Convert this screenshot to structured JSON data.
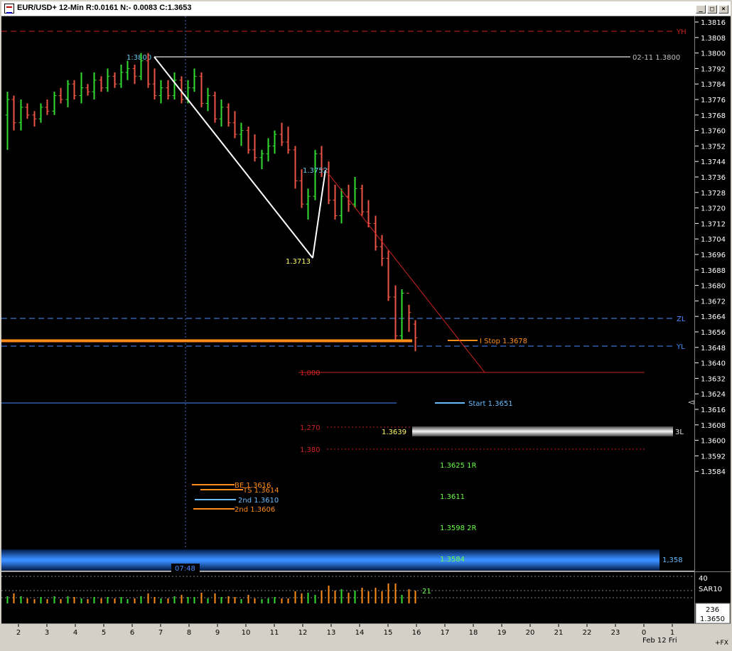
{
  "window": {
    "title": "EUR/USD+ 12-Min R:0.0161 N:- 0.0083 C:1.3653",
    "minimize_glyph": "_",
    "maximize_glyph": "□",
    "close_glyph": "×"
  },
  "chart_data": {
    "type": "candlestick",
    "symbol": "EUR/USD+",
    "interval": "12-Min",
    "ylim": [
      1.358,
      1.382
    ],
    "y_ticks": [
      "1.3816",
      "1.3808",
      "1.3800",
      "1.3792",
      "1.3784",
      "1.3776",
      "1.3768",
      "1.3760",
      "1.3752",
      "1.3744",
      "1.3736",
      "1.3728",
      "1.3720",
      "1.3712",
      "1.3704",
      "1.3696",
      "1.3688",
      "1.3680",
      "1.3672",
      "1.3664",
      "1.3656",
      "1.3648",
      "1.3640",
      "1.3632",
      "1.3624",
      "1.3616",
      "1.3608",
      "1.3600",
      "1.3592",
      "1.3584"
    ],
    "x_ticks": [
      "2",
      "3",
      "4",
      "5",
      "6",
      "7",
      "8",
      "9",
      "10",
      "11",
      "12",
      "13",
      "14",
      "15",
      "16",
      "17",
      "18",
      "19",
      "20",
      "21",
      "22",
      "23",
      "0",
      "1"
    ],
    "date_label": "Feb 12 Fri",
    "crosshair_time": "07:48",
    "bars": [
      [
        1.3768,
        1.378,
        1.375,
        1.3776
      ],
      [
        1.3776,
        1.3778,
        1.376,
        1.3764
      ],
      [
        1.3764,
        1.3776,
        1.376,
        1.3772
      ],
      [
        1.3772,
        1.3774,
        1.3766,
        1.3768
      ],
      [
        1.3768,
        1.377,
        1.3762,
        1.3766
      ],
      [
        1.3766,
        1.3774,
        1.3764,
        1.3772
      ],
      [
        1.3772,
        1.3776,
        1.3768,
        1.377
      ],
      [
        1.377,
        1.378,
        1.3768,
        1.3778
      ],
      [
        1.3778,
        1.3782,
        1.3774,
        1.3776
      ],
      [
        1.3776,
        1.3786,
        1.3772,
        1.3784
      ],
      [
        1.3784,
        1.3786,
        1.3776,
        1.3778
      ],
      [
        1.3778,
        1.379,
        1.3774,
        1.3782
      ],
      [
        1.3782,
        1.3784,
        1.3778,
        1.378
      ],
      [
        1.378,
        1.379,
        1.3776,
        1.3786
      ],
      [
        1.3786,
        1.3788,
        1.378,
        1.3782
      ],
      [
        1.3782,
        1.3792,
        1.378,
        1.3788
      ],
      [
        1.3788,
        1.379,
        1.3782,
        1.3784
      ],
      [
        1.3784,
        1.3794,
        1.3782,
        1.379
      ],
      [
        1.379,
        1.3796,
        1.3786,
        1.3792
      ],
      [
        1.3792,
        1.3794,
        1.3784,
        1.3788
      ],
      [
        1.3788,
        1.38,
        1.3786,
        1.3796
      ],
      [
        1.3796,
        1.38,
        1.3782,
        1.3784
      ],
      [
        1.3784,
        1.3792,
        1.3776,
        1.3778
      ],
      [
        1.3778,
        1.3786,
        1.3774,
        1.3782
      ],
      [
        1.3782,
        1.3786,
        1.3776,
        1.3778
      ],
      [
        1.3778,
        1.379,
        1.3776,
        1.3786
      ],
      [
        1.3786,
        1.3788,
        1.3774,
        1.3776
      ],
      [
        1.3776,
        1.3786,
        1.3774,
        1.3782
      ],
      [
        1.3782,
        1.3792,
        1.378,
        1.3788
      ],
      [
        1.3788,
        1.379,
        1.3772,
        1.3774
      ],
      [
        1.3774,
        1.3782,
        1.377,
        1.3778
      ],
      [
        1.3778,
        1.378,
        1.3764,
        1.3766
      ],
      [
        1.3766,
        1.3776,
        1.3762,
        1.3772
      ],
      [
        1.3772,
        1.3774,
        1.3762,
        1.3764
      ],
      [
        1.3764,
        1.377,
        1.3756,
        1.3758
      ],
      [
        1.3758,
        1.3764,
        1.3752,
        1.376
      ],
      [
        1.376,
        1.3762,
        1.3748,
        1.375
      ],
      [
        1.375,
        1.3758,
        1.3744,
        1.3746
      ],
      [
        1.3746,
        1.375,
        1.374,
        1.3748
      ],
      [
        1.3748,
        1.3756,
        1.3744,
        1.3752
      ],
      [
        1.3752,
        1.376,
        1.3748,
        1.3758
      ],
      [
        1.3758,
        1.3764,
        1.3752,
        1.3754
      ],
      [
        1.3754,
        1.3762,
        1.3748,
        1.375
      ],
      [
        1.375,
        1.3752,
        1.373,
        1.3734
      ],
      [
        1.3734,
        1.374,
        1.372,
        1.3722
      ],
      [
        1.3722,
        1.373,
        1.3714,
        1.3726
      ],
      [
        1.3726,
        1.375,
        1.3724,
        1.3748
      ],
      [
        1.3748,
        1.3752,
        1.3736,
        1.374
      ],
      [
        1.374,
        1.3744,
        1.3722,
        1.3724
      ],
      [
        1.3724,
        1.3732,
        1.3714,
        1.3716
      ],
      [
        1.3716,
        1.373,
        1.3712,
        1.3726
      ],
      [
        1.3726,
        1.3732,
        1.3718,
        1.3722
      ],
      [
        1.3722,
        1.3736,
        1.372,
        1.373
      ],
      [
        1.373,
        1.3732,
        1.3716,
        1.3718
      ],
      [
        1.3718,
        1.3724,
        1.371,
        1.3712
      ],
      [
        1.3712,
        1.3716,
        1.3698,
        1.37
      ],
      [
        1.37,
        1.3706,
        1.369,
        1.3694
      ],
      [
        1.3694,
        1.3698,
        1.3672,
        1.3674
      ],
      [
        1.3674,
        1.368,
        1.3652,
        1.3654
      ],
      [
        1.3654,
        1.3678,
        1.3652,
        1.3676
      ],
      [
        1.3676,
        1.367,
        1.3656,
        1.3666
      ],
      [
        1.366,
        1.3662,
        1.3646,
        1.3653
      ]
    ],
    "volume_label": "SAR10",
    "volume_value": "21",
    "volume_scale_top": "40",
    "bottom_box": [
      "236",
      "1.3650"
    ],
    "fx_label": "+FX"
  },
  "levels": {
    "yh": "YH",
    "zl": "ZL",
    "yl": "YL",
    "three_l": "3L",
    "fib_1000": "1,000",
    "fib_1270": "1,270",
    "fib_1380": "1,380",
    "high_label": "1:3800",
    "high_tag": "02-11  1.3800",
    "low1_label": "1.3713",
    "swing_label": "1.3752",
    "low_label": "1.3639",
    "istop": "I Stop 1.3678",
    "start": "Start 1.3651",
    "t1": "1.3625  1R",
    "t2": "1.3611",
    "t3": "1.3598  2R",
    "t4": "1.3584",
    "band_tag": "1,358",
    "be": "BE 1.3616",
    "ts": "TS 1.3614",
    "second_blue": "2nd  1.3610",
    "second_orange": "2nd  1.3606"
  },
  "colors": {
    "background": "#000000",
    "bull": "#33dd33",
    "bear": "#ee5544",
    "orange": "#ff8c1a",
    "blue": "#4a8cff",
    "cyan": "#66ccee",
    "yellow": "#ffff66",
    "green_text": "#66ff44",
    "red": "#cc2222"
  }
}
